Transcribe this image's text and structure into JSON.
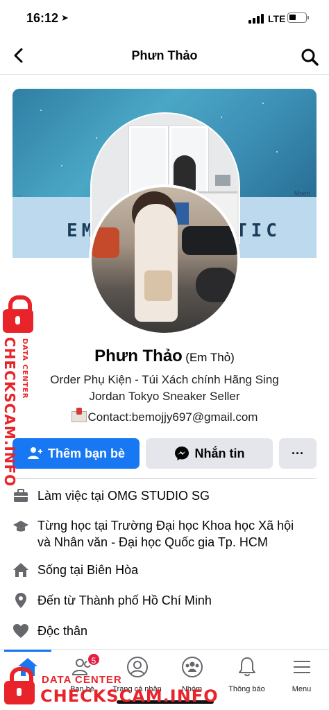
{
  "status_bar": {
    "time": "16:12",
    "network": "LTE"
  },
  "header": {
    "title": "Phưn Thảo"
  },
  "cover": {
    "text_left": "EM",
    "text_right": "TIC",
    "tiny_left": "...",
    "tiny_right": "Moon"
  },
  "profile": {
    "name": "Phưn Thảo",
    "alt_name": "(Em Thỏ)",
    "bio_line1": "Order Phụ Kiện - Túi Xách chính Hãng Sing",
    "bio_line2": "Jordan Tokyo Sneaker Seller",
    "contact": "Contact:bemojjy697@gmail.com"
  },
  "actions": {
    "add_friend": "Thêm bạn bè",
    "message": "Nhắn tin",
    "more": "···"
  },
  "info": {
    "work_prefix": "Làm việc tại ",
    "work_value": "OMG STUDIO SG",
    "study_prefix": "Từng học tại ",
    "study_value_1": "Trường Đại học Khoa học Xã hội",
    "study_value_2": "và Nhân văn - Đại học Quốc gia Tp. HCM",
    "live_prefix": "Sống tại ",
    "live_value": "Biên Hòa",
    "from_prefix": "Đến từ ",
    "from_value": "Thành phố Hồ Chí Minh",
    "relationship": "Độc thân"
  },
  "tabbar": {
    "home": "tin",
    "friends": "Bạn bè",
    "friends_badge": "5",
    "profile": "Trang cá nhân",
    "groups": "Nhóm",
    "notifications": "Thông báo",
    "menu": "Menu"
  },
  "watermark": {
    "vertical_big": "CHECKSCAM.INFO",
    "vertical_small": "DATA CENTER",
    "bottom_small": "DATA CENTER",
    "bottom_big": "CHECKSCAM.INFO"
  },
  "colors": {
    "accent": "#1877f2",
    "button_gray": "#e4e6eb",
    "watermark_red": "#e8232a",
    "badge_red": "#e41e3f"
  }
}
